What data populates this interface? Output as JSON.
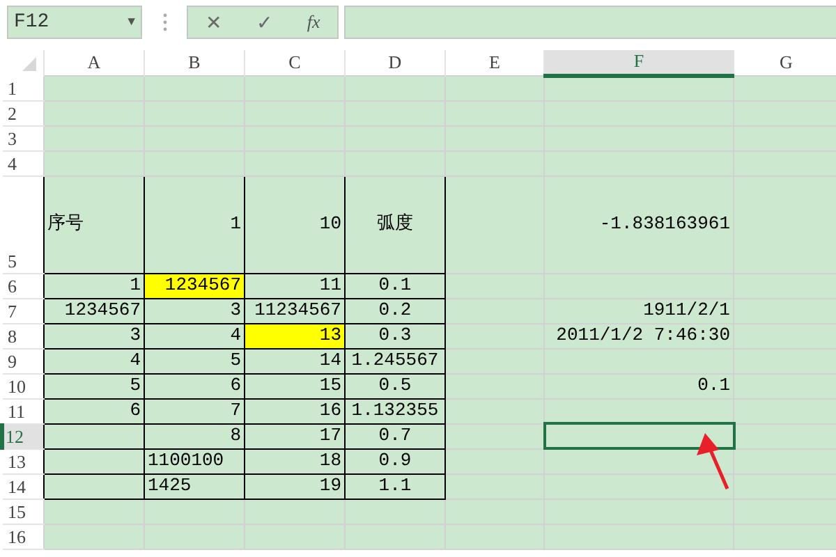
{
  "name_box": {
    "value": "F12",
    "dropdown": "▼"
  },
  "formula_bar": {
    "cancel": "✕",
    "enter": "✓",
    "function": "fx"
  },
  "columns": [
    {
      "label": "A",
      "selected": false
    },
    {
      "label": "B",
      "selected": false
    },
    {
      "label": "C",
      "selected": false
    },
    {
      "label": "D",
      "selected": false
    },
    {
      "label": "E",
      "selected": false
    },
    {
      "label": "F",
      "selected": true
    },
    {
      "label": "G",
      "selected": false
    }
  ],
  "rows": [
    {
      "label": "1",
      "selected": false,
      "cells": {}
    },
    {
      "label": "2",
      "selected": false,
      "cells": {}
    },
    {
      "label": "3",
      "selected": false,
      "cells": {}
    },
    {
      "label": "4",
      "selected": false,
      "cells": {}
    },
    {
      "label": "5",
      "selected": false,
      "tall": true,
      "cells": {
        "A": {
          "text": "序号",
          "kind": "text",
          "bordered": true
        },
        "B": {
          "text": "1",
          "kind": "number",
          "bordered": true
        },
        "C": {
          "text": "10",
          "kind": "number",
          "bordered": true
        },
        "D": {
          "text": "弧度",
          "kind": "centered",
          "bordered": true
        },
        "F": {
          "text": "-1.838163961",
          "kind": "number"
        }
      }
    },
    {
      "label": "6",
      "selected": false,
      "cells": {
        "A": {
          "text": "1",
          "kind": "number",
          "bordered": true
        },
        "B": {
          "text": "1234567",
          "kind": "number",
          "bordered": true,
          "color": "#ffff00"
        },
        "C": {
          "text": "11",
          "kind": "number",
          "bordered": true
        },
        "D": {
          "text": "0.1",
          "kind": "centered",
          "bordered": true
        }
      }
    },
    {
      "label": "7",
      "selected": false,
      "cells": {
        "A": {
          "text": "1234567",
          "kind": "number",
          "bordered": true
        },
        "B": {
          "text": "3",
          "kind": "number",
          "bordered": true
        },
        "C": {
          "text": "11234567",
          "kind": "number",
          "bordered": true
        },
        "D": {
          "text": "0.2",
          "kind": "centered",
          "bordered": true
        },
        "F": {
          "text": "1911/2/1",
          "kind": "number"
        }
      }
    },
    {
      "label": "8",
      "selected": false,
      "cells": {
        "A": {
          "text": "3",
          "kind": "number",
          "bordered": true
        },
        "B": {
          "text": "4",
          "kind": "number",
          "bordered": true
        },
        "C": {
          "text": "13",
          "kind": "number",
          "bordered": true,
          "color": "#ffff00"
        },
        "D": {
          "text": "0.3",
          "kind": "centered",
          "bordered": true
        },
        "F": {
          "text": "2011/1/2 7:46:30",
          "kind": "number"
        }
      }
    },
    {
      "label": "9",
      "selected": false,
      "cells": {
        "A": {
          "text": "4",
          "kind": "number",
          "bordered": true
        },
        "B": {
          "text": "5",
          "kind": "number",
          "bordered": true
        },
        "C": {
          "text": "14",
          "kind": "number",
          "bordered": true
        },
        "D": {
          "text": "1.245567",
          "kind": "centered",
          "bordered": true
        }
      }
    },
    {
      "label": "10",
      "selected": false,
      "cells": {
        "A": {
          "text": "5",
          "kind": "number",
          "bordered": true
        },
        "B": {
          "text": "6",
          "kind": "number",
          "bordered": true
        },
        "C": {
          "text": "15",
          "kind": "number",
          "bordered": true
        },
        "D": {
          "text": "0.5",
          "kind": "centered",
          "bordered": true
        },
        "F": {
          "text": "0.1",
          "kind": "number"
        }
      }
    },
    {
      "label": "11",
      "selected": false,
      "cells": {
        "A": {
          "text": "6",
          "kind": "number",
          "bordered": true
        },
        "B": {
          "text": "7",
          "kind": "number",
          "bordered": true
        },
        "C": {
          "text": "16",
          "kind": "number",
          "bordered": true
        },
        "D": {
          "text": "1.132355",
          "kind": "centered",
          "bordered": true
        }
      }
    },
    {
      "label": "12",
      "selected": true,
      "cells": {
        "A": {
          "bordered": true
        },
        "B": {
          "text": "8",
          "kind": "number",
          "bordered": true
        },
        "C": {
          "text": "17",
          "kind": "number",
          "bordered": true
        },
        "D": {
          "text": "0.7",
          "kind": "centered",
          "bordered": true
        },
        "F": {
          "active": true
        }
      }
    },
    {
      "label": "13",
      "selected": false,
      "cells": {
        "A": {
          "bordered": true
        },
        "B": {
          "text": "1100100",
          "kind": "text",
          "bordered": true
        },
        "C": {
          "text": "18",
          "kind": "number",
          "bordered": true
        },
        "D": {
          "text": "0.9",
          "kind": "centered",
          "bordered": true
        }
      }
    },
    {
      "label": "14",
      "selected": false,
      "cells": {
        "A": {
          "bordered": true
        },
        "B": {
          "text": "1425",
          "kind": "text",
          "bordered": true
        },
        "C": {
          "text": "19",
          "kind": "number",
          "bordered": true
        },
        "D": {
          "text": "1.1",
          "kind": "centered",
          "bordered": true
        }
      }
    },
    {
      "label": "15",
      "selected": false,
      "cells": {}
    },
    {
      "label": "16",
      "selected": false,
      "cells": {}
    }
  ]
}
